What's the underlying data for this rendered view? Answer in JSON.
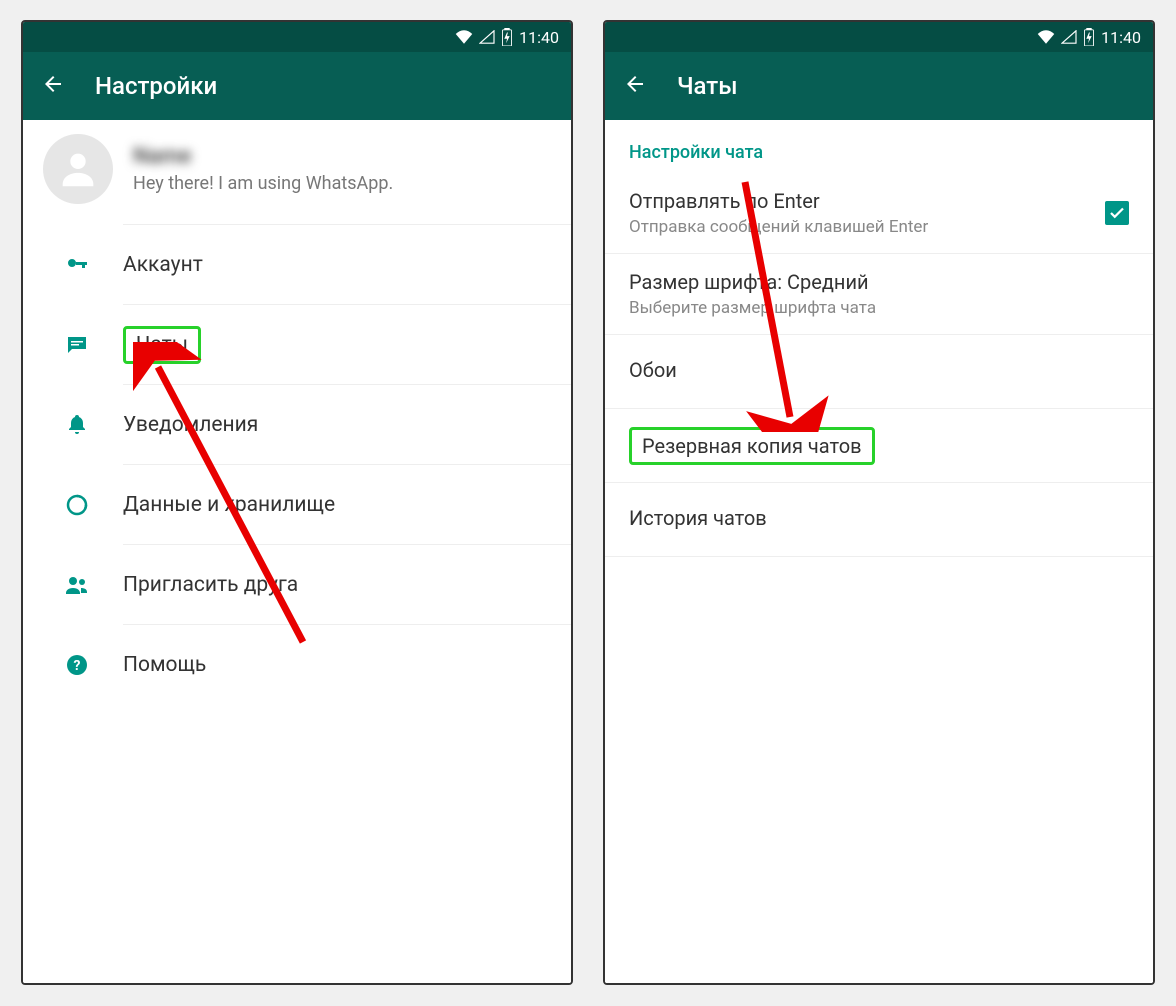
{
  "status": {
    "time": "11:40"
  },
  "left": {
    "header_title": "Настройки",
    "profile": {
      "name": "Name",
      "status_text": "Hey there! I am using WhatsApp."
    },
    "menu": {
      "account": "Аккаунт",
      "chats": "Чаты",
      "notifications": "Уведомления",
      "data": "Данные и хранилище",
      "invite": "Пригласить друга",
      "help": "Помощь"
    }
  },
  "right": {
    "header_title": "Чаты",
    "section_title": "Настройки чата",
    "enter_send": {
      "title": "Отправлять по Enter",
      "subtitle": "Отправка сообщений клавишей Enter",
      "checked": true
    },
    "font_size": {
      "title": "Размер шрифта: Средний",
      "subtitle": "Выберите размер шрифта чата"
    },
    "wallpaper": "Обои",
    "backup": "Резервная копия чатов",
    "history": "История чатов"
  }
}
